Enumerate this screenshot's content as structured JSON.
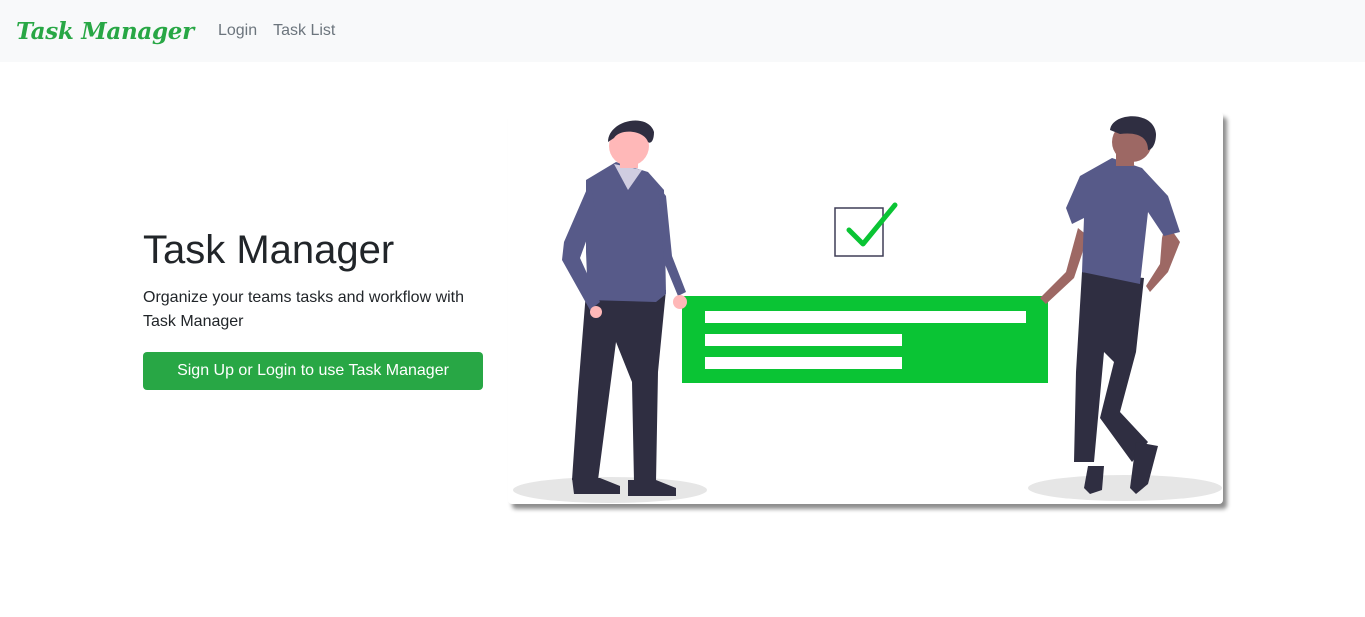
{
  "navbar": {
    "brand": "Task Manager",
    "links": [
      {
        "label": "Login"
      },
      {
        "label": "Task List"
      }
    ]
  },
  "hero": {
    "title": "Task Manager",
    "subtitle": "Organize your teams tasks and workflow with Task Manager",
    "cta_label": "Sign Up or Login to use Task Manager"
  },
  "colors": {
    "brand": "#28a745",
    "navbar_bg": "#f8f9fa",
    "illustration_green": "#0ac434",
    "shirt": "#575a89",
    "pants": "#2f2e41"
  },
  "illustration": {
    "icons": [
      "checkbox-check-icon",
      "document-lines-icon"
    ]
  }
}
